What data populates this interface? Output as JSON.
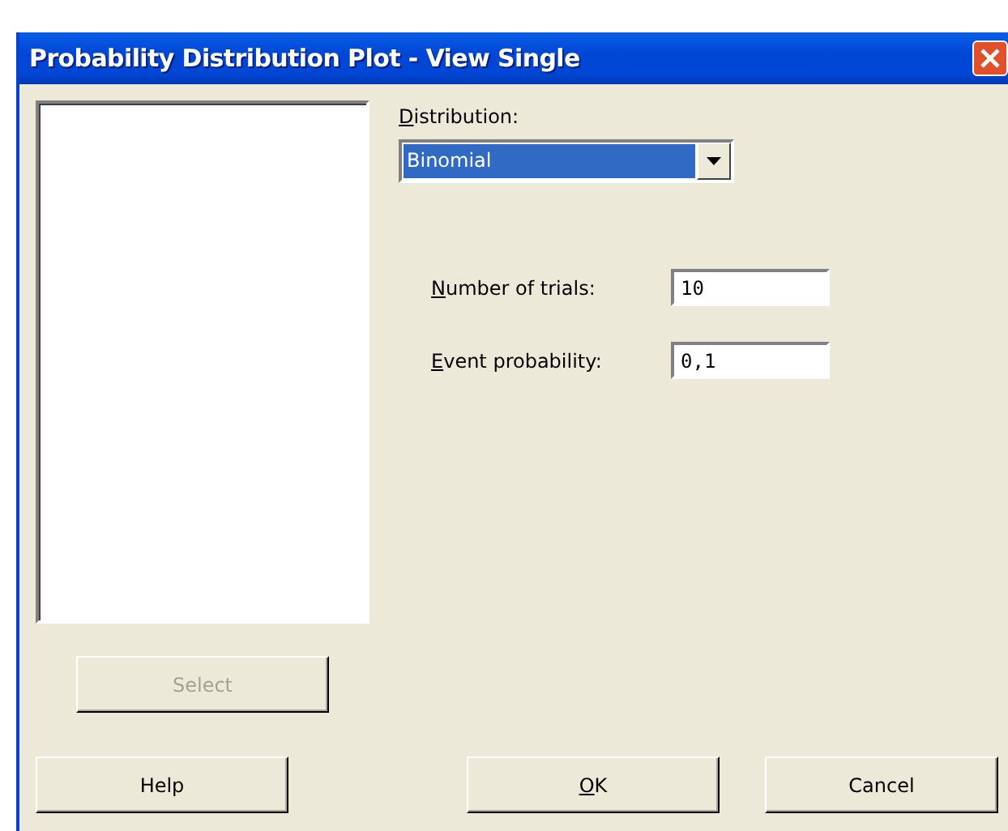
{
  "window": {
    "title": "Probability Distribution Plot - View Single"
  },
  "select_button": {
    "label": "Select",
    "disabled": true
  },
  "distribution": {
    "label": "Distribution:",
    "access_key": true,
    "value": "Binomial"
  },
  "parameters": [
    {
      "label": "Number of trials:",
      "access_key": true,
      "value": "10"
    },
    {
      "label": "Event probability:",
      "access_key": true,
      "value": "0,1"
    }
  ],
  "buttons": [
    {
      "label": "Help",
      "kind": "help",
      "access_key": false
    },
    {
      "label": "OK",
      "kind": "ok",
      "access_key": true
    },
    {
      "label": "Cancel",
      "kind": "cancel",
      "access_key": false
    }
  ]
}
